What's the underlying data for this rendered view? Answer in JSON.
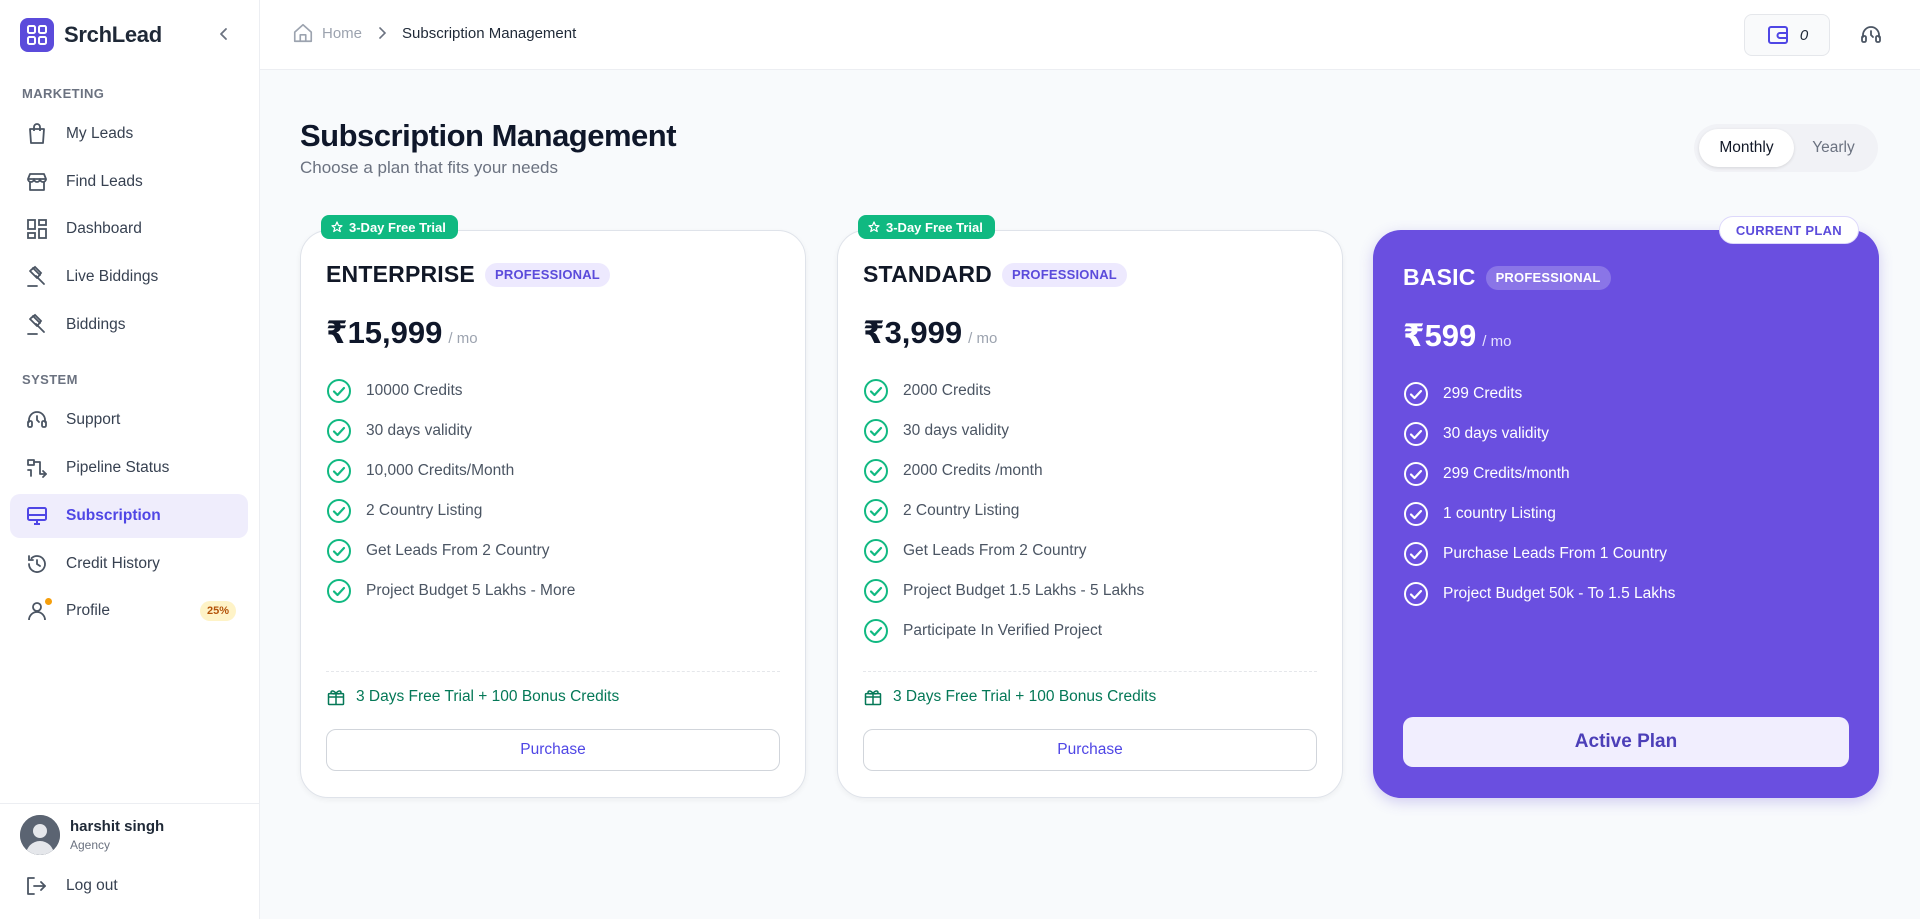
{
  "app": {
    "name": "SrchLead"
  },
  "sidebar": {
    "sections": [
      {
        "title": "MARKETING"
      },
      {
        "title": "SYSTEM"
      }
    ],
    "items": [
      {
        "label": "My Leads",
        "icon": "bag-icon"
      },
      {
        "label": "Find Leads",
        "icon": "store-icon"
      },
      {
        "label": "Dashboard",
        "icon": "dashboard-icon"
      },
      {
        "label": "Live Biddings",
        "icon": "gavel-icon"
      },
      {
        "label": "Biddings",
        "icon": "gavel-icon"
      },
      {
        "label": "Support",
        "icon": "headset-icon"
      },
      {
        "label": "Pipeline Status",
        "icon": "pipeline-icon"
      },
      {
        "label": "Subscription",
        "icon": "monitor-icon",
        "active": true
      },
      {
        "label": "Credit History",
        "icon": "history-icon"
      },
      {
        "label": "Profile",
        "icon": "user-icon",
        "badge": "25%",
        "progress": 0.25
      }
    ],
    "user": {
      "name": "harshit singh",
      "role": "Agency"
    },
    "logout_label": "Log out"
  },
  "header": {
    "breadcrumb": {
      "home": "Home",
      "current": "Subscription Management"
    },
    "credits": "0"
  },
  "main": {
    "title": "Subscription Management",
    "subtitle": "Choose a plan that fits your needs",
    "billing": {
      "monthly": "Monthly",
      "yearly": "Yearly",
      "selected": "Monthly"
    }
  },
  "plans": [
    {
      "name": "ENTERPRISE",
      "tier": "PROFESSIONAL",
      "badge": "3-Day Free Trial",
      "price": "₹15,999",
      "period": "/ mo",
      "features": [
        "10000 Credits",
        "30 days validity",
        "10,000 Credits/Month",
        "2 Country Listing",
        "Get Leads From 2 Country",
        "Project Budget 5 Lakhs - More"
      ],
      "bonus": "3 Days Free Trial + 100 Bonus Credits",
      "cta": "Purchase"
    },
    {
      "name": "STANDARD",
      "tier": "PROFESSIONAL",
      "badge": "3-Day Free Trial",
      "price": "₹3,999",
      "period": "/ mo",
      "features": [
        "2000 Credits",
        "30 days validity",
        "2000 Credits /month",
        "2 Country Listing",
        "Get Leads From 2 Country",
        "Project Budget 1.5 Lakhs - 5 Lakhs",
        "Participate In Verified Project"
      ],
      "bonus": "3 Days Free Trial + 100 Bonus Credits",
      "cta": "Purchase"
    },
    {
      "name": "BASIC",
      "tier": "PROFESSIONAL",
      "badge": "CURRENT PLAN",
      "price": "₹599",
      "period": "/ mo",
      "features": [
        "299 Credits",
        "30 days validity",
        "299 Credits/month",
        "1 country Listing",
        "Purchase Leads From 1 Country",
        "Project Budget 50k - To 1.5 Lakhs"
      ],
      "cta": "Active Plan"
    }
  ],
  "colors": {
    "brand": "#5b4bdb",
    "current_plan_bg": "#6a4fe0",
    "trial_badge": "#10b981",
    "check": "#10b981"
  }
}
